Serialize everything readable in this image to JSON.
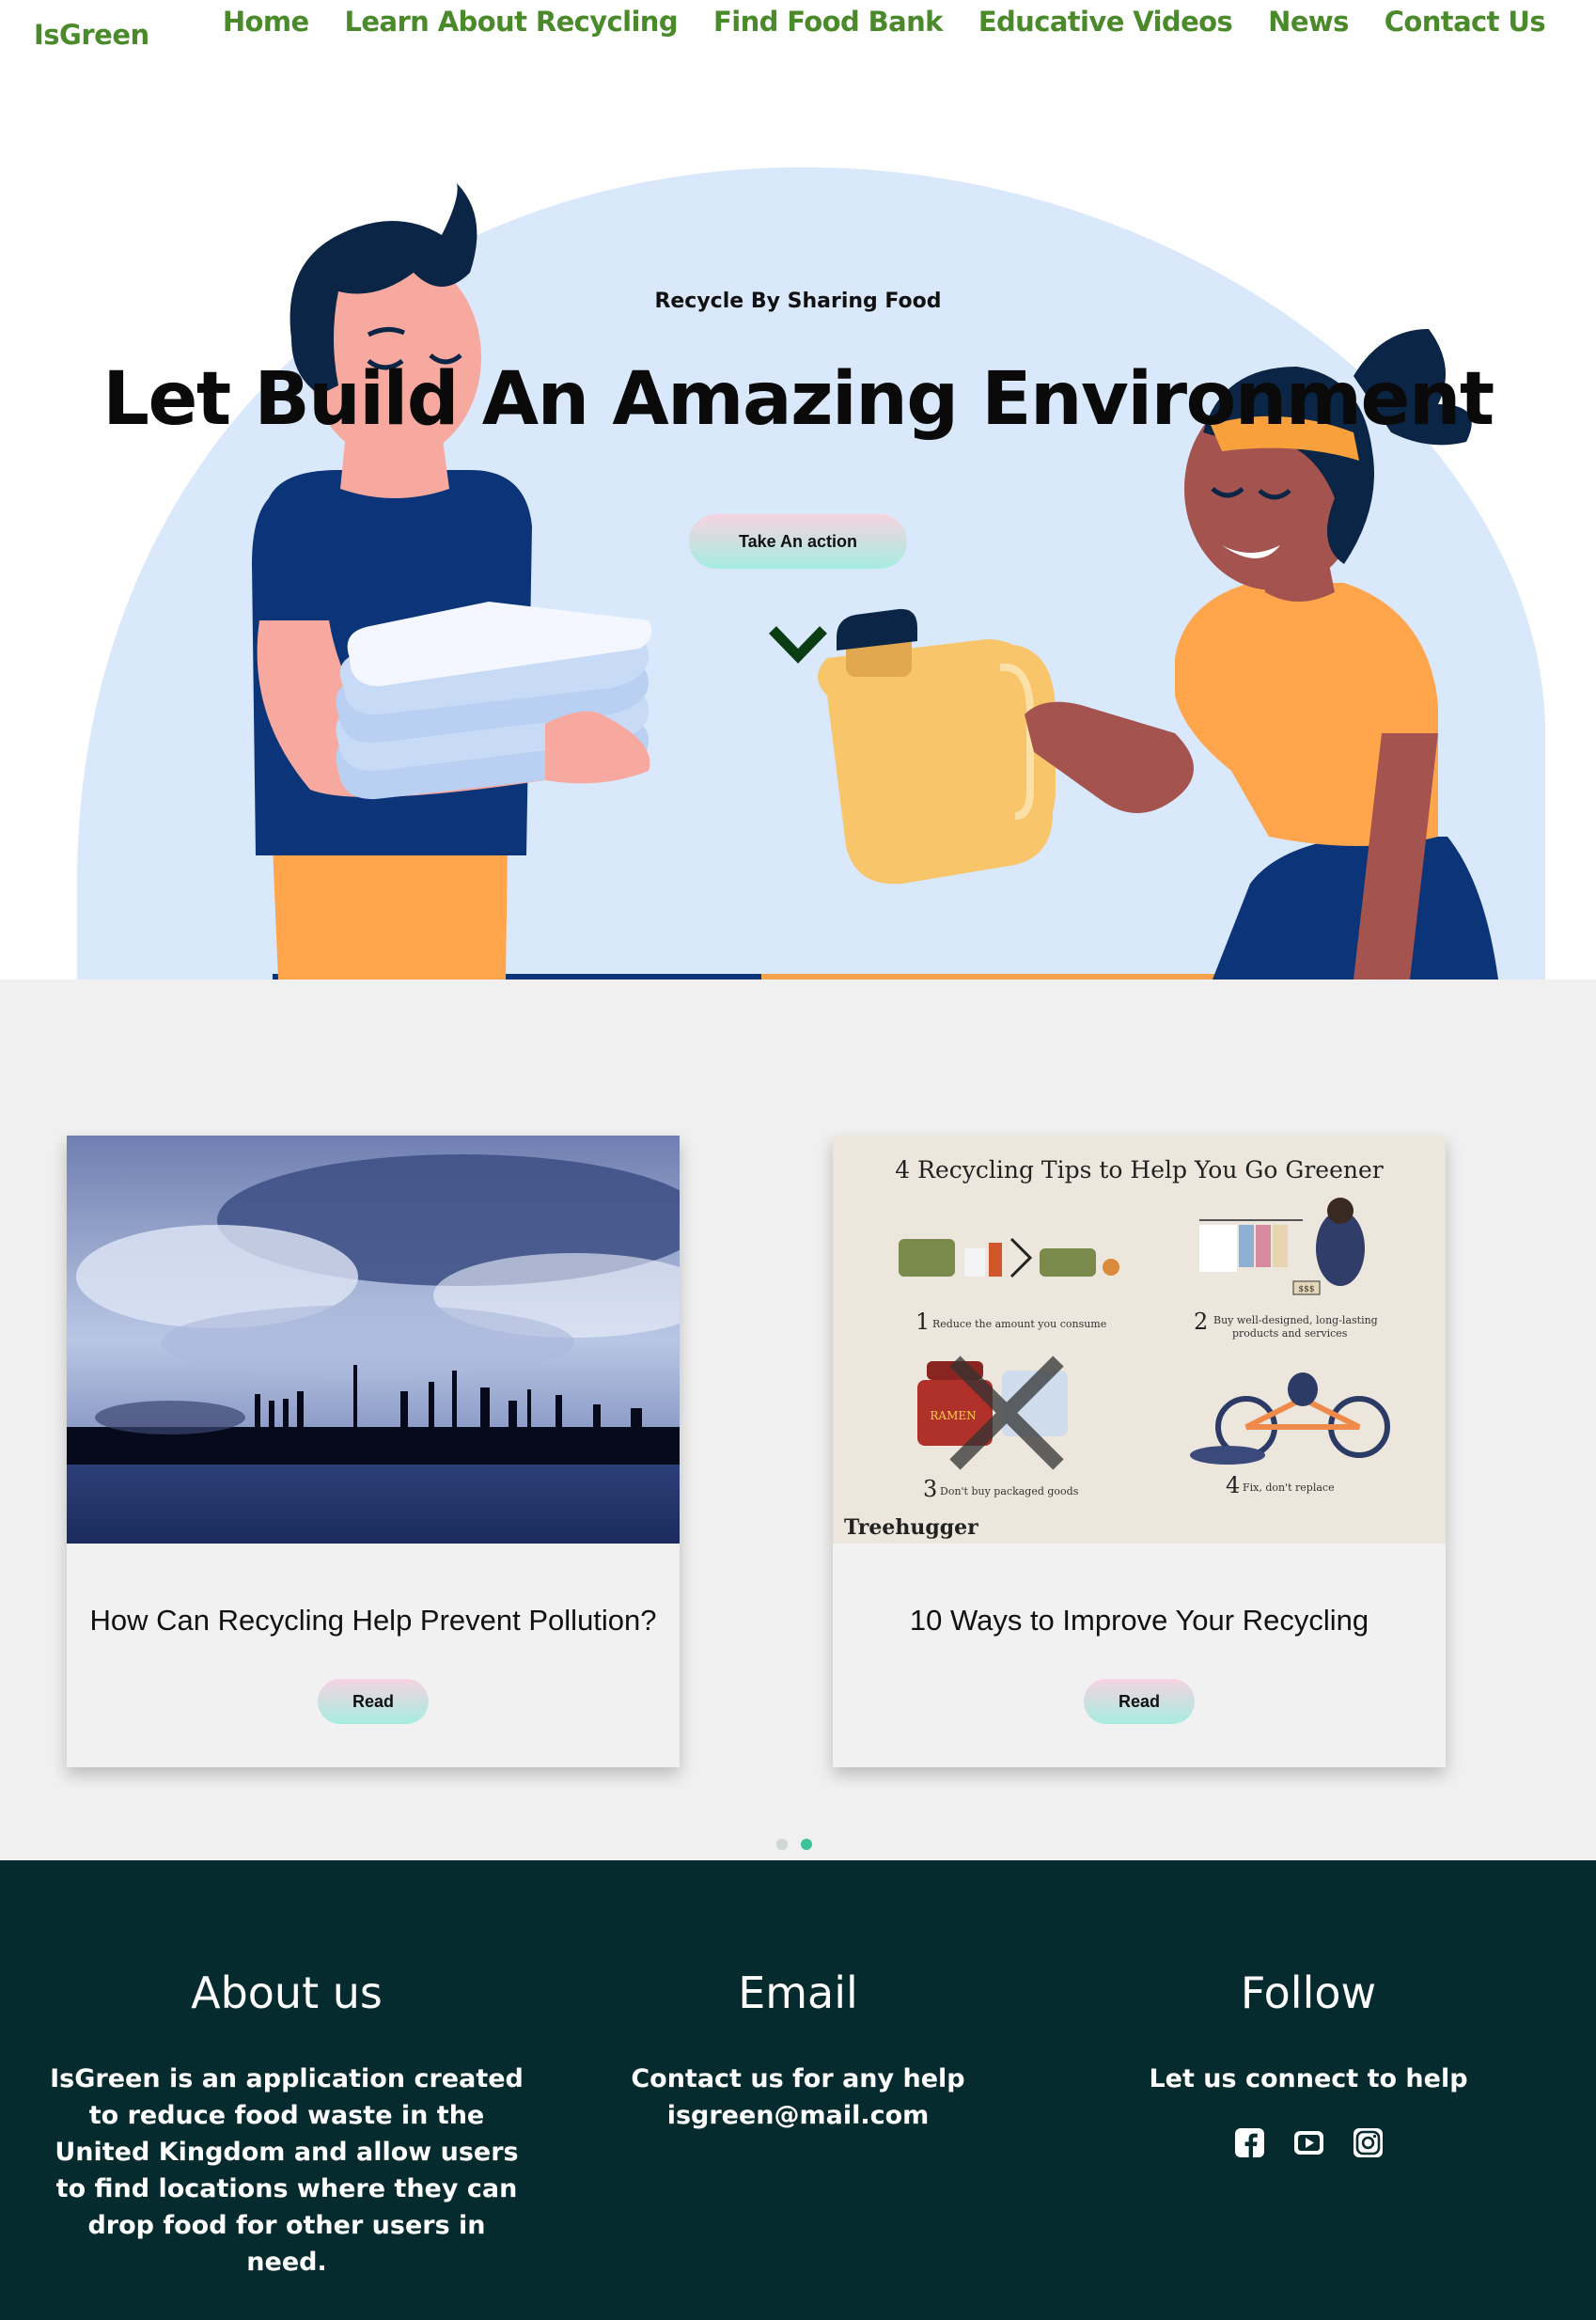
{
  "brand": {
    "logo": "IsGreen",
    "color": "#4a8a2a"
  },
  "nav": {
    "items": [
      "Home",
      "Learn About Recycling",
      "Find Food Bank",
      "Educative Videos",
      "News",
      "Contact Us"
    ]
  },
  "hero": {
    "eyebrow": "Recycle By Sharing Food",
    "title": "Let Build An Amazing Environment",
    "cta": "Take An action",
    "scroll_icon": "chevron-down-icon"
  },
  "news": {
    "cards": [
      {
        "title": "How Can Recycling Help Prevent Pollution?",
        "button": "Read",
        "image": "industrial-skyline-photo"
      },
      {
        "title": "10 Ways to Improve Your Recycling",
        "button": "Read",
        "image": "recycling-tips-infographic",
        "infographic": {
          "heading": "4 Recycling Tips to Help You Go Greener",
          "tip1": "Reduce the amount you consume",
          "tip2a": "Buy well-designed, long-lasting",
          "tip2b": "products and services",
          "tip3": "Don't buy packaged goods",
          "tip4": "Fix, don't replace",
          "n1": "1",
          "n2": "2",
          "n3": "3",
          "n4": "4",
          "source": "Treehugger",
          "tag": "$$$",
          "pkg": "RAMEN"
        }
      }
    ],
    "carousel": {
      "count": 2,
      "active": 2
    }
  },
  "footer": {
    "about": {
      "heading": "About us",
      "text": "IsGreen is an application created to reduce food waste in the United Kingdom and allow users to find locations where they can drop food for other users in need."
    },
    "email": {
      "heading": "Email",
      "line1": "Contact us for any help",
      "line2": "isgreen@mail.com"
    },
    "follow": {
      "heading": "Follow",
      "text": "Let us connect to help",
      "icons": [
        "facebook-icon",
        "youtube-icon",
        "instagram-icon"
      ]
    }
  },
  "colors": {
    "footer_bg": "#062b2e",
    "section_bg": "#f0f0f0",
    "hero_circle": "#d9e8fb",
    "dot_active": "#3ec29a"
  }
}
